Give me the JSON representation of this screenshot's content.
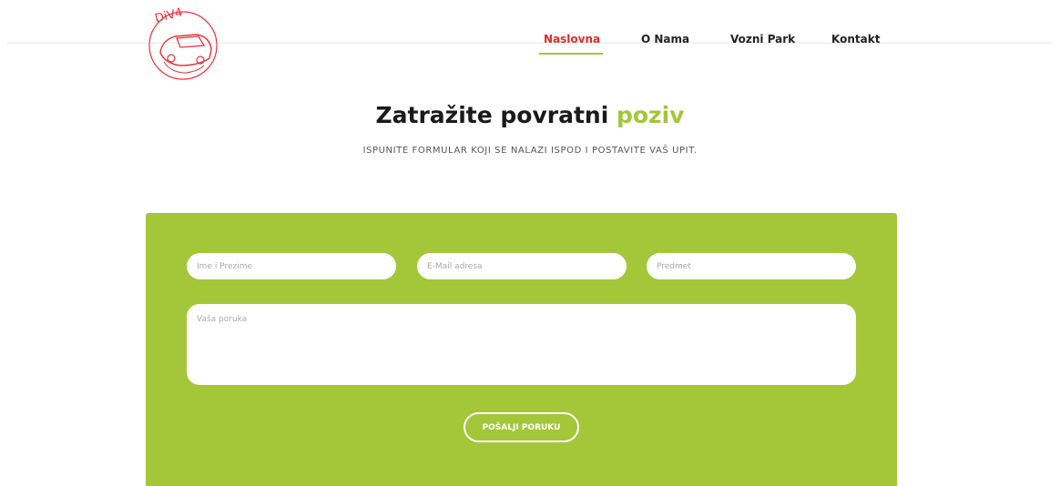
{
  "brand": {
    "logo_text": "DiV4",
    "logo_color": "#e8323c"
  },
  "nav": {
    "items": [
      {
        "label": "Naslovna",
        "active": true
      },
      {
        "label": "O Nama",
        "active": false
      },
      {
        "label": "Vozni Park",
        "active": false
      },
      {
        "label": "Kontakt",
        "active": false
      }
    ]
  },
  "page": {
    "title_main": "Zatražite povratni",
    "title_accent": "poziv",
    "subtitle": "ISPUNITE FORMULAR KOJI SE NALAZI ISPOD I POSTAVITE VAŠ UPIT."
  },
  "form": {
    "name_placeholder": "Ime i Prezime",
    "email_placeholder": "E-Mail adresa",
    "subject_placeholder": "Predmet",
    "message_placeholder": "Vaša poruka",
    "submit_label": "POŠALJI PORUKU"
  },
  "colors": {
    "accent_green": "#a4c639",
    "active_nav_red": "#e32a2a",
    "heading_dark": "#1a1a1a"
  }
}
